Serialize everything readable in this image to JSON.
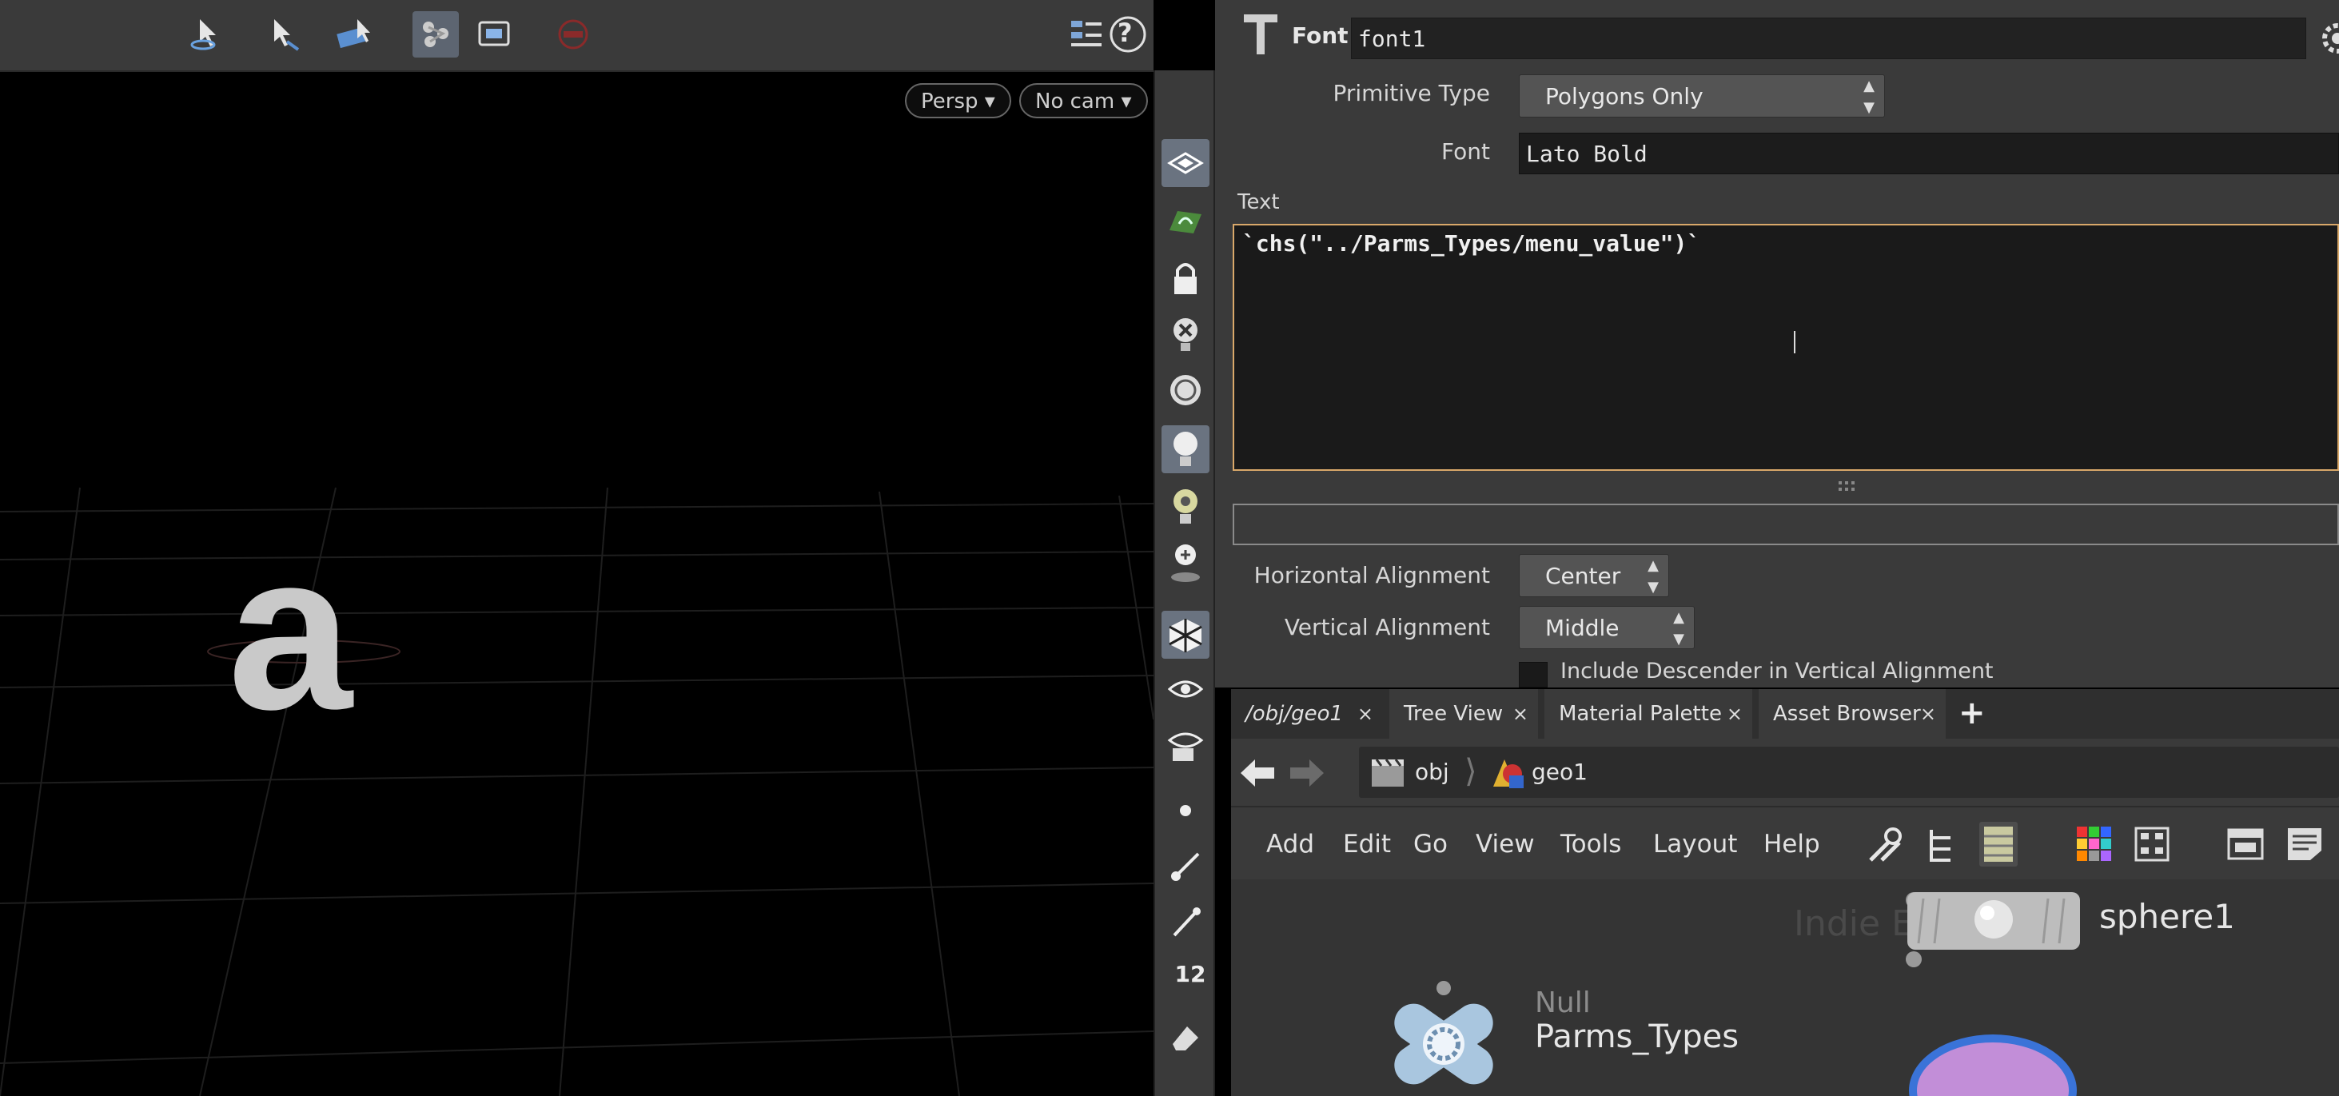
{
  "viewport": {
    "camera_menu": "Persp",
    "cam_menu": "No cam",
    "help": "?",
    "display_letter": "a"
  },
  "params": {
    "node_type": "Font",
    "node_name": "font1",
    "primitive_type_label": "Primitive Type",
    "primitive_type_value": "Polygons Only",
    "font_label": "Font",
    "font_value": "Lato Bold",
    "text_label": "Text",
    "text_value": "`chs(\"../Parms_Types/menu_value\")`",
    "h_align_label": "Horizontal Alignment",
    "h_align_value": "Center",
    "v_align_label": "Vertical Alignment",
    "v_align_value": "Middle",
    "descender_label": "Include Descender in Vertical Alignment"
  },
  "network": {
    "tabs": [
      {
        "label": "/obj/geo1"
      },
      {
        "label": "Tree View"
      },
      {
        "label": "Material Palette"
      },
      {
        "label": "Asset Browser"
      }
    ],
    "tab_close": "×",
    "add_tab": "+",
    "path": [
      "obj",
      "geo1"
    ],
    "menu": [
      "Add",
      "Edit",
      "Go",
      "View",
      "Tools",
      "Layout",
      "Help"
    ],
    "watermark": "Indie E",
    "nodes": {
      "sphere_name": "sphere1",
      "null_type": "Null",
      "null_name": "Parms_Types"
    },
    "shelf_counter": "12"
  }
}
